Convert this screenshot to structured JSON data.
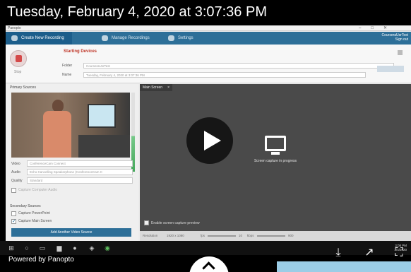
{
  "overlay": {
    "title": "Tuesday, February 4, 2020 at 3:07:36 PM",
    "powered_by": "Powered by Panopto"
  },
  "window": {
    "app_name": "Panopto",
    "controls": [
      "–",
      "□",
      "✕"
    ]
  },
  "nav": {
    "create_recording": "Create New Recording",
    "manage_recordings": "Manage Recordings",
    "settings": "Settings",
    "user": "CourseraUsrTest",
    "sign_out": "Sign out"
  },
  "recording": {
    "record_label": "Stop",
    "status": "Starting Devices",
    "folder_label": "Folder",
    "folder_value": "CourseraUsrTest",
    "name_label": "Name",
    "name_value": "Tuesday, February 4, 2020 at 3:07:36 PM"
  },
  "primary_sources": {
    "title": "Primary Sources",
    "video_label": "Video",
    "video_value": "ConferenceCam Connect",
    "audio_label": "Audio",
    "audio_value": "Echo Cancelling Speakerphone (ConferenceCam C",
    "quality_label": "Quality",
    "quality_value": "Standard",
    "capture_computer_audio": "Capture Computer Audio"
  },
  "secondary_sources": {
    "title": "Secondary Sources",
    "capture_powerpoint": "Capture PowerPoint",
    "capture_powerpoint_checked": false,
    "capture_main_screen": "Capture Main Screen",
    "capture_main_screen_checked": true,
    "add_button": "Add Another Video Source"
  },
  "preview": {
    "tab_label": "Main Screen",
    "tab_close": "×",
    "capture_message": "Screen capture in progress",
    "enable_preview": "Enable screen capture preview",
    "resolution_label": "Resolution",
    "resolution_value": "1920 x 1080",
    "fps_label": "fps",
    "fps_value": "10",
    "kbps_label": "kbps",
    "kbps_value": "900"
  },
  "taskbar": {
    "time": "3:08 PM",
    "date": "2/4/2020"
  },
  "colors": {
    "accent": "#2d6f98",
    "status_red": "#c0392b",
    "overlay_bg": "#000000",
    "footer_strip": "#9bcde6"
  },
  "icons": {
    "play": "play-icon",
    "download": "download-icon",
    "share": "share-arrow-icon",
    "fullscreen": "fullscreen-icon",
    "monitor": "monitor-icon",
    "chevron": "chevron-up-icon"
  }
}
